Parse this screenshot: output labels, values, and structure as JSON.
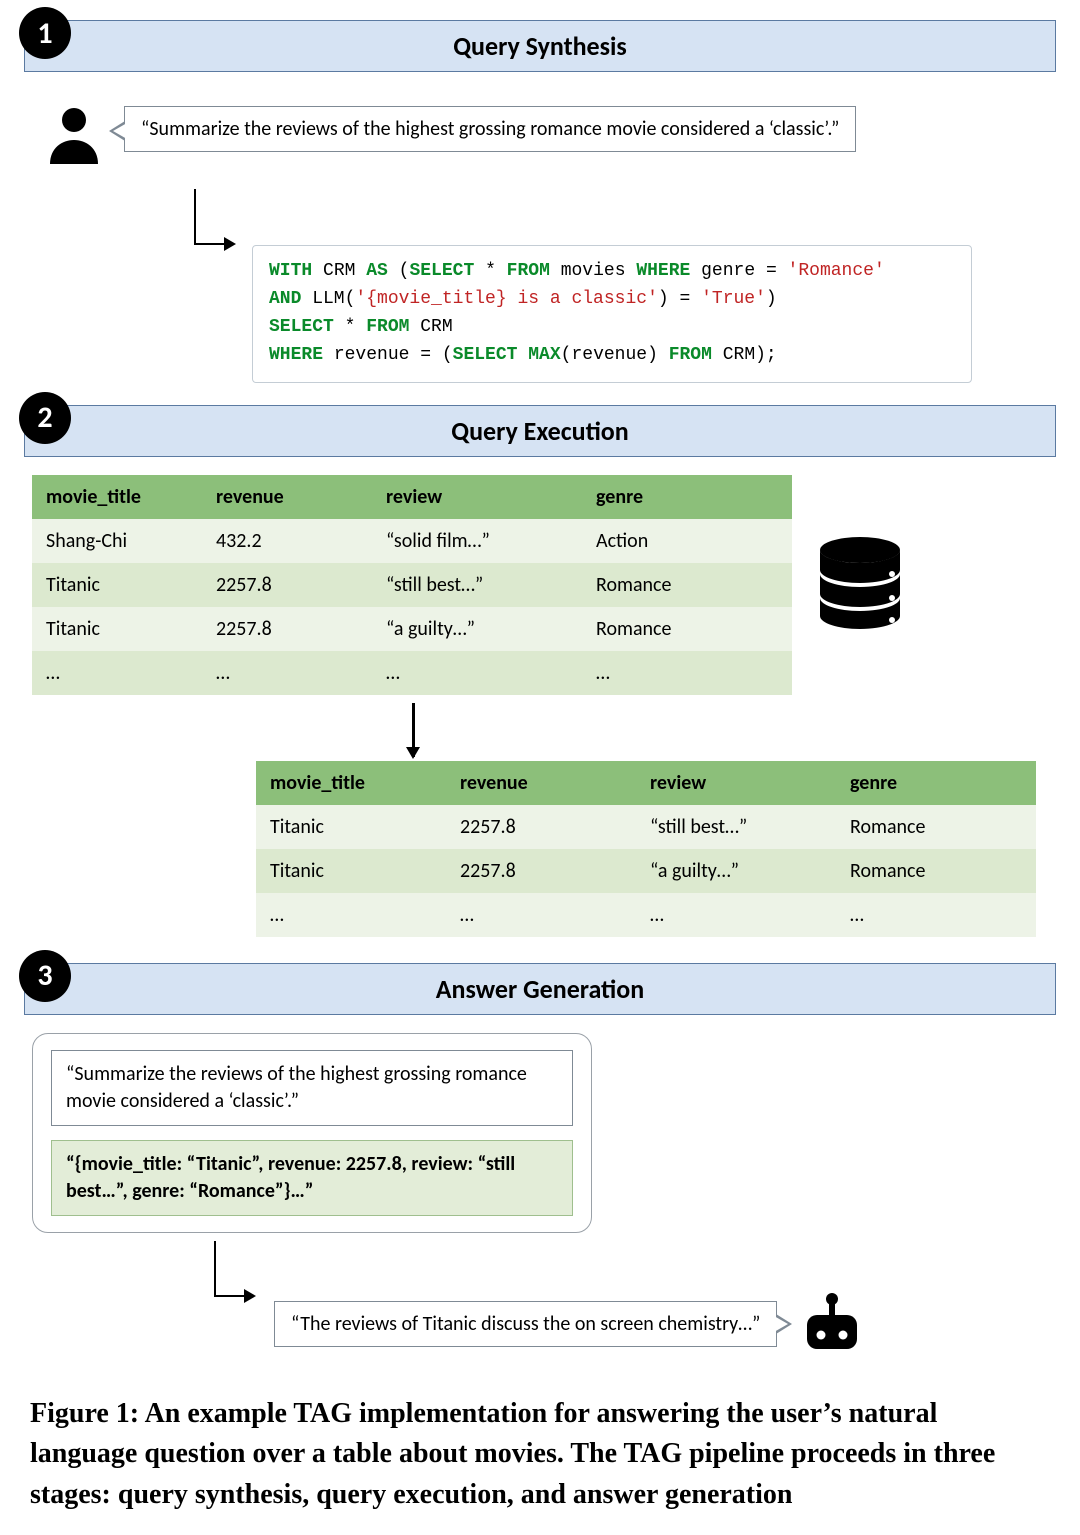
{
  "stages": [
    {
      "num": "1",
      "title": "Query Synthesis"
    },
    {
      "num": "2",
      "title": "Query Execution"
    },
    {
      "num": "3",
      "title": "Answer Generation"
    }
  ],
  "stage1": {
    "user_query": "“Summarize the reviews of the highest grossing romance movie considered a ‘classic’.”",
    "sql": {
      "l1a": "WITH",
      "l1b": " CRM ",
      "l1c": "AS",
      "l1d": " (",
      "l1e": "SELECT",
      "l1f": " * ",
      "l1g": "FROM",
      "l1h": " movies ",
      "l1i": "WHERE",
      "l1j": " genre = ",
      "l1k": "'Romance'",
      "l2a": "AND",
      "l2b": " LLM(",
      "l2c": "'{movie_title} is a classic'",
      "l2d": ") = ",
      "l2e": "'True'",
      "l2f": ")",
      "l3a": "SELECT",
      "l3b": " * ",
      "l3c": "FROM",
      "l3d": " CRM",
      "l4a": "WHERE",
      "l4b": " revenue = (",
      "l4c": "SELECT MAX",
      "l4d": "(revenue) ",
      "l4e": "FROM",
      "l4f": " CRM);"
    }
  },
  "stage2": {
    "columns": [
      "movie_title",
      "revenue",
      "review",
      "genre"
    ],
    "table1": [
      [
        "Shang-Chi",
        "432.2",
        "“solid film…”",
        "Action"
      ],
      [
        "Titanic",
        "2257.8",
        "“still best…”",
        "Romance"
      ],
      [
        "Titanic",
        "2257.8",
        "“a guilty…”",
        "Romance"
      ],
      [
        "…",
        "…",
        "…",
        "…"
      ]
    ],
    "table2": [
      [
        "Titanic",
        "2257.8",
        "“still best…”",
        "Romance"
      ],
      [
        "Titanic",
        "2257.8",
        "“a guilty…”",
        "Romance"
      ],
      [
        "…",
        "…",
        "…",
        "…"
      ]
    ]
  },
  "stage3": {
    "prompt_query": "“Summarize the reviews of the highest grossing romance movie considered a ‘classic’.”",
    "prompt_data": "“{movie_title: “Titanic”, revenue: 2257.8, review: “still best…”, genre: “Romance”}…”",
    "answer": "“The reviews of Titanic discuss the on screen chemistry…”"
  },
  "caption": "Figure 1: An example TAG implementation for answering the user’s natural language question over a table about movies. The TAG pipeline proceeds in three stages: query synthesis, query execution, and answer generation"
}
